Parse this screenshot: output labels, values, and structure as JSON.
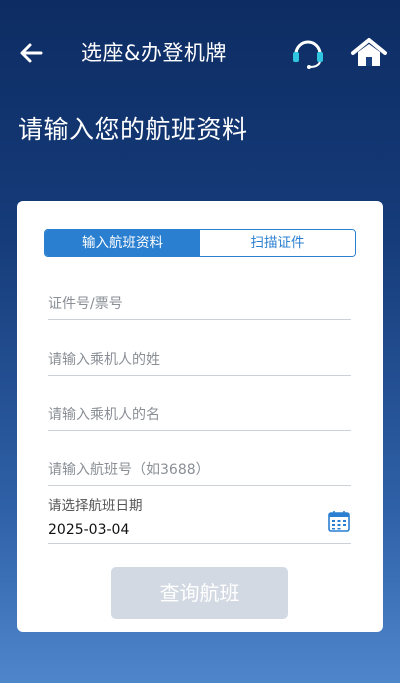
{
  "header": {
    "title": "选座&办登机牌",
    "back_icon": "back-arrow-icon",
    "service_icon": "customer-service-headset-icon",
    "home_icon": "home-icon"
  },
  "heading": "请输入您的航班资料",
  "tabs": [
    {
      "label": "输入航班资料",
      "active": true
    },
    {
      "label": "扫描证件",
      "active": false
    }
  ],
  "form": {
    "id_number_placeholder": "证件号/票号",
    "surname_placeholder": "请输入乘机人的姓",
    "given_name_placeholder": "请输入乘机人的名",
    "flight_number_placeholder": "请输入航班号（如3688）",
    "date_label": "请选择航班日期",
    "date_value": "2025-03-04",
    "calendar_icon": "calendar-icon"
  },
  "query_button": "查询航班",
  "colors": {
    "accent": "#2a7fd0",
    "header_top": "#0d2c63",
    "background_bottom": "#4f86cb",
    "button_disabled": "#d2d9e2"
  }
}
